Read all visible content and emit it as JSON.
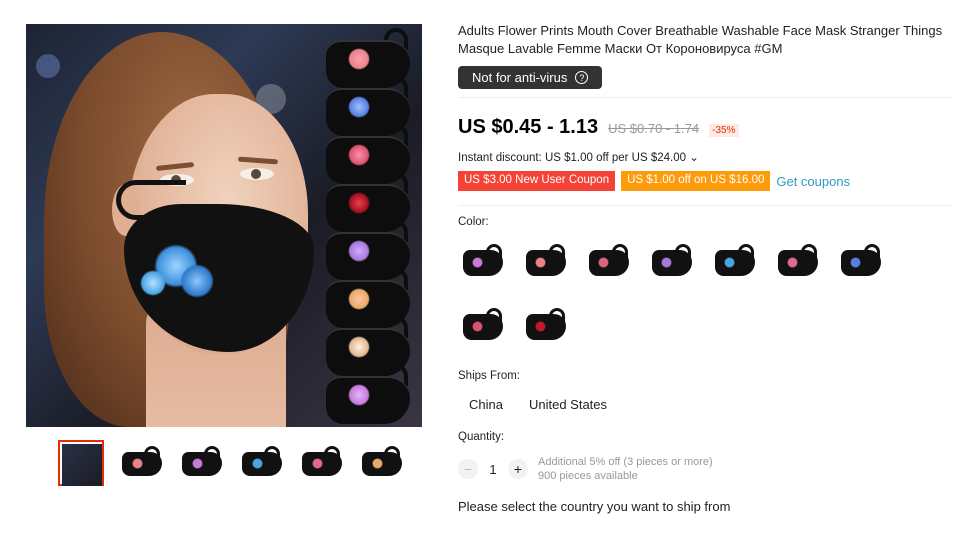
{
  "product": {
    "title": "Adults Flower Prints Mouth Cover Breathable Washable Face Mask Stranger Things Masque Lavable Femme Маски От Короновируса #GM",
    "badge": "Not for anti-virus",
    "price": "US $0.45 - 1.13",
    "original_price": "US $0.70 - 1.74",
    "discount": "-35%",
    "instant_discount": "Instant discount: US $1.00 off per US $24.00 ⌄",
    "coupons": [
      "US $3.00 New User Coupon",
      "US $1.00 off on US $16.00"
    ],
    "get_coupons": "Get coupons"
  },
  "color": {
    "label": "Color:",
    "swatches": [
      {
        "name": "color-1",
        "print": "#c77bd6"
      },
      {
        "name": "color-2",
        "print": "#e8838a"
      },
      {
        "name": "color-3",
        "print": "#d66a7c"
      },
      {
        "name": "color-4",
        "print": "#a77ad9"
      },
      {
        "name": "color-5",
        "print": "#4aa6e3"
      },
      {
        "name": "color-6",
        "print": "#e06a95"
      },
      {
        "name": "color-7",
        "print": "#5a7de0"
      },
      {
        "name": "color-8",
        "print": "#d9546d"
      },
      {
        "name": "color-9",
        "print": "#c0192b"
      }
    ]
  },
  "ships_from": {
    "label": "Ships From:",
    "options": [
      "China",
      "United States"
    ]
  },
  "quantity": {
    "label": "Quantity:",
    "value": "1",
    "minus": "−",
    "plus": "+",
    "note_line1": "Additional 5% off (3 pieces or more)",
    "note_line2": "900 pieces available"
  },
  "footer_text": "Please select the country you want to ship from",
  "gallery": {
    "thumb_prints": [
      "#e8838a",
      "#c77bd6",
      "#4aa6e3",
      "#e06a95",
      "#e9a96a"
    ]
  }
}
